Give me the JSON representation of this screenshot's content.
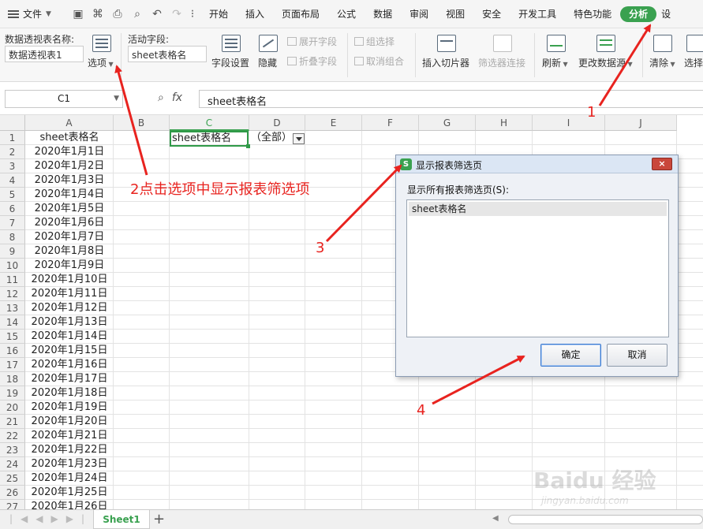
{
  "menubar": {
    "file_label": "文件",
    "tabs": [
      "开始",
      "插入",
      "页面布局",
      "公式",
      "数据",
      "审阅",
      "视图",
      "安全",
      "开发工具",
      "特色功能",
      "分析",
      "设"
    ],
    "active_tab": "分析"
  },
  "ribbon": {
    "pivot_name_label": "数据透视表名称:",
    "pivot_name_value": "数据透视表1",
    "options_label": "选项",
    "active_field_label": "活动字段:",
    "active_field_value": "sheet表格名",
    "field_settings": "字段设置",
    "hide": "隐藏",
    "expand_field": "展开字段",
    "collapse_field": "折叠字段",
    "group_selection": "组选择",
    "ungroup": "取消组合",
    "insert_slicer": "插入切片器",
    "filter_connections": "筛选器连接",
    "refresh": "刷新",
    "change_source": "更改数据源",
    "clear": "清除",
    "select": "选择"
  },
  "formula_bar": {
    "name_box": "C1",
    "fx_label": "fx",
    "content": "sheet表格名"
  },
  "grid": {
    "columns": [
      "A",
      "B",
      "C",
      "D",
      "E",
      "F",
      "G",
      "H",
      "I",
      "J"
    ],
    "selected_column": "C",
    "rows": [
      "1",
      "2",
      "3",
      "4",
      "5",
      "6",
      "7",
      "8",
      "9",
      "10",
      "11",
      "12",
      "13",
      "14",
      "15",
      "16",
      "17",
      "18",
      "19",
      "20",
      "21",
      "22",
      "23",
      "24",
      "25",
      "26",
      "27"
    ],
    "column_a": [
      "sheet表格名",
      "2020年1月1日",
      "2020年1月2日",
      "2020年1月3日",
      "2020年1月4日",
      "2020年1月5日",
      "2020年1月6日",
      "2020年1月7日",
      "2020年1月8日",
      "2020年1月9日",
      "2020年1月10日",
      "2020年1月11日",
      "2020年1月12日",
      "2020年1月13日",
      "2020年1月14日",
      "2020年1月15日",
      "2020年1月16日",
      "2020年1月17日",
      "2020年1月18日",
      "2020年1月19日",
      "2020年1月20日",
      "2020年1月21日",
      "2020年1月22日",
      "2020年1月23日",
      "2020年1月24日",
      "2020年1月25日",
      "2020年1月26日"
    ],
    "c1": "sheet表格名",
    "d1": "（全部）"
  },
  "sheet_tabs": {
    "active": "Sheet1",
    "add": "+"
  },
  "dialog": {
    "title": "显示报表筛选页",
    "logo": "S",
    "close": "×",
    "label": "显示所有报表筛选页(S):",
    "items": [
      "sheet表格名"
    ],
    "ok": "确定",
    "cancel": "取消"
  },
  "annotations": {
    "a1": "1",
    "a2": "2点击选项中显示报表筛选项",
    "a3": "3",
    "a4": "4",
    "color": "#e8231f"
  },
  "watermark": {
    "brand": "Baidu 经验",
    "url": "jingyan.baidu.com"
  }
}
